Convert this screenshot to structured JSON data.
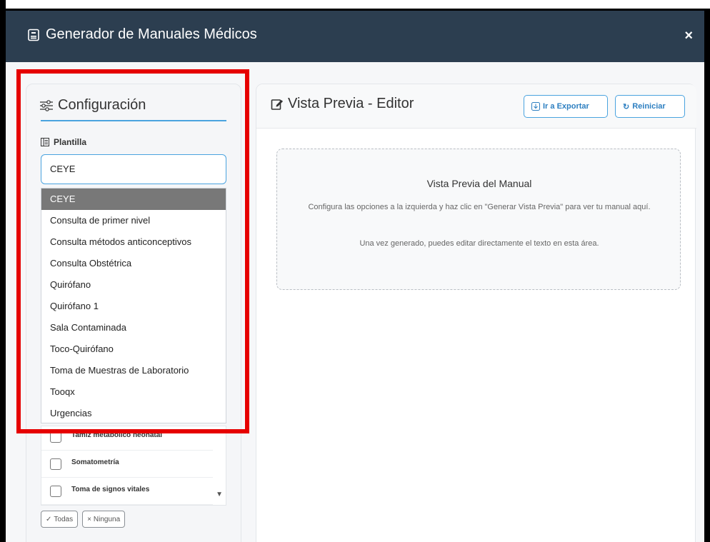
{
  "modal": {
    "title": "Generador de Manuales Médicos",
    "close": "×"
  },
  "config": {
    "title": "Configuración",
    "plantilla_label": "Plantilla",
    "selected_value": "CEYE",
    "options": [
      "CEYE",
      "Consulta de primer nivel",
      "Consulta métodos anticonceptivos",
      "Consulta Obstétrica",
      "Quirófano",
      "Quirófano 1",
      "Sala Contaminada",
      "Toco-Quirófano",
      "Toma de Muestras de Laboratorio",
      "Tooqx",
      "Urgencias"
    ],
    "checklist": [
      "Tamiz metabólico neonatal",
      "Somatometría",
      "Toma de signos vitales"
    ],
    "btn_all": "Todas",
    "btn_none": "Ninguna"
  },
  "preview": {
    "title": "Vista Previa - Editor",
    "btn_export": "Ir a Exportar",
    "btn_reset": "Reiniciar",
    "box_title": "Vista Previa del Manual",
    "box_desc": "Configura las opciones a la izquierda y haz clic en \"Generar Vista Previa\" para ver tu manual aquí.",
    "box_note": "Una vez generado, puedes editar directamente el texto en esta área."
  },
  "colors": {
    "header_bg": "#2c3e50",
    "accent": "#4aa3df",
    "highlight": "#e60000"
  }
}
